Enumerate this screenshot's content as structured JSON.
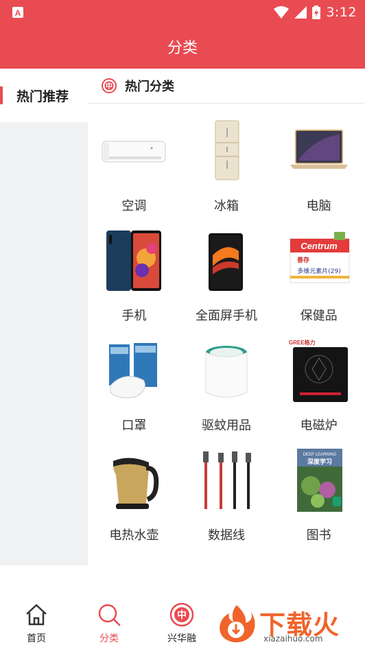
{
  "status_bar": {
    "time": "3:12",
    "app_icon": "A"
  },
  "header": {
    "title": "分类"
  },
  "sidebar": {
    "items": [
      {
        "label": "热门推荐",
        "active": true
      }
    ]
  },
  "content": {
    "section_title": "热门分类",
    "section_icon": "中"
  },
  "categories": [
    {
      "label": "空调",
      "icon": "air-conditioner"
    },
    {
      "label": "冰箱",
      "icon": "refrigerator"
    },
    {
      "label": "电脑",
      "icon": "laptop"
    },
    {
      "label": "手机",
      "icon": "smartphone"
    },
    {
      "label": "全面屏手机",
      "icon": "full-screen-phone"
    },
    {
      "label": "保健品",
      "icon": "supplements"
    },
    {
      "label": "口罩",
      "icon": "face-mask"
    },
    {
      "label": "驱蚊用品",
      "icon": "mosquito-repeller"
    },
    {
      "label": "电磁炉",
      "icon": "induction-cooker"
    },
    {
      "label": "电热水壶",
      "icon": "electric-kettle"
    },
    {
      "label": "数据线",
      "icon": "data-cable"
    },
    {
      "label": "图书",
      "icon": "book"
    }
  ],
  "product_text": {
    "supplements_brand": "Centrum",
    "supplements_sub": "善存",
    "supplements_label": "多维元素片(29)",
    "cooker_brand": "GREE格力",
    "book_title": "深度学习",
    "book_en": "DEEP LEARNING"
  },
  "bottom_nav": [
    {
      "label": "首页",
      "icon": "home-icon",
      "active": false
    },
    {
      "label": "分类",
      "icon": "search-icon",
      "active": true
    },
    {
      "label": "兴华融",
      "icon": "xinghuarong-icon",
      "active": false
    }
  ],
  "watermark": {
    "main": "下载火",
    "sub": "xiazaihuo.com"
  },
  "colors": {
    "accent": "#e94b52",
    "sidebar_bg": "#f0f1f3"
  }
}
